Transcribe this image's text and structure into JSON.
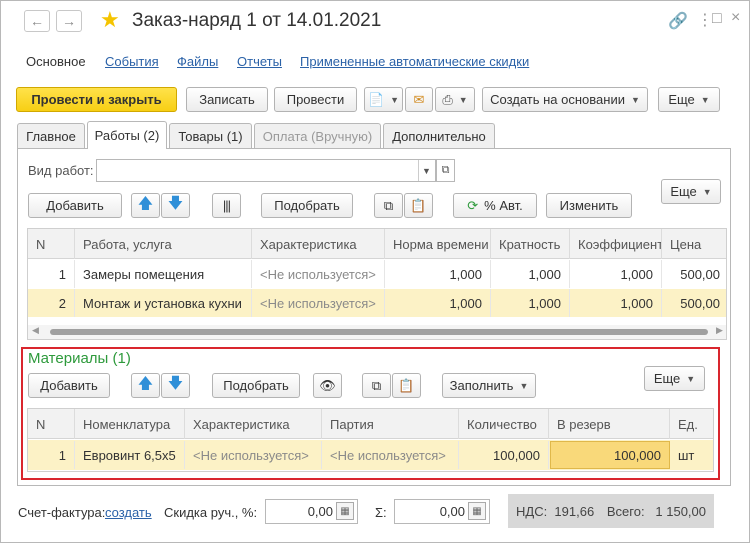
{
  "window": {
    "title": "Заказ-наряд 1 от 14.01.2021"
  },
  "sections": [
    {
      "label": "Основное"
    },
    {
      "label": "События"
    },
    {
      "label": "Файлы"
    },
    {
      "label": "Отчеты"
    },
    {
      "label": "Примененные автоматические скидки"
    }
  ],
  "toolbar": {
    "post_close": "Провести и закрыть",
    "save": "Записать",
    "post": "Провести",
    "create_based": "Создать на основании",
    "more": "Еще"
  },
  "tabs": [
    {
      "label": "Главное"
    },
    {
      "label": "Работы (2)"
    },
    {
      "label": "Товары (1)"
    },
    {
      "label": "Оплата (Вручную)"
    },
    {
      "label": "Дополнительно"
    }
  ],
  "works": {
    "kind_label": "Вид работ:",
    "kind_value": "",
    "add": "Добавить",
    "pick": "Подобрать",
    "auto": "% Авт.",
    "change": "Изменить",
    "more": "Еще",
    "columns": [
      "N",
      "Работа, услуга",
      "Характеристика",
      "Норма времени",
      "Кратность",
      "Коэффициент",
      "Цена"
    ],
    "rows": [
      {
        "n": "1",
        "name": "Замеры помещения",
        "char": "<Не используется>",
        "norm": "1,000",
        "mult": "1,000",
        "coef": "1,000",
        "price": "500,00"
      },
      {
        "n": "2",
        "name": "Монтаж и установка кухни",
        "char": "<Не используется>",
        "norm": "1,000",
        "mult": "1,000",
        "coef": "1,000",
        "price": "500,00"
      }
    ]
  },
  "materials": {
    "title": "Материалы (1)",
    "add": "Добавить",
    "pick": "Подобрать",
    "fill": "Заполнить",
    "more": "Еще",
    "columns": [
      "N",
      "Номенклатура",
      "Характеристика",
      "Партия",
      "Количество",
      "В резерв",
      "Ед."
    ],
    "rows": [
      {
        "n": "1",
        "item": "Евровинт 6,5х5",
        "char": "<Не используется>",
        "batch": "<Не используется>",
        "qty": "100,000",
        "reserve": "100,000",
        "unit": "шт"
      }
    ]
  },
  "footer": {
    "invoice_label": "Счет-фактура:",
    "invoice_link": "создать",
    "discount_label": "Скидка руч., %:",
    "discount_value": "0,00",
    "sigma_label": "Σ:",
    "sigma_value": "0,00",
    "vat": "НДС:  191,66",
    "total": "Всего:   1 150,00"
  },
  "colors": {
    "accent_yellow": "#f7cf14",
    "materials_frame": "#d9262e",
    "materials_title": "#2e9a3c",
    "link": "#2b62a8"
  }
}
